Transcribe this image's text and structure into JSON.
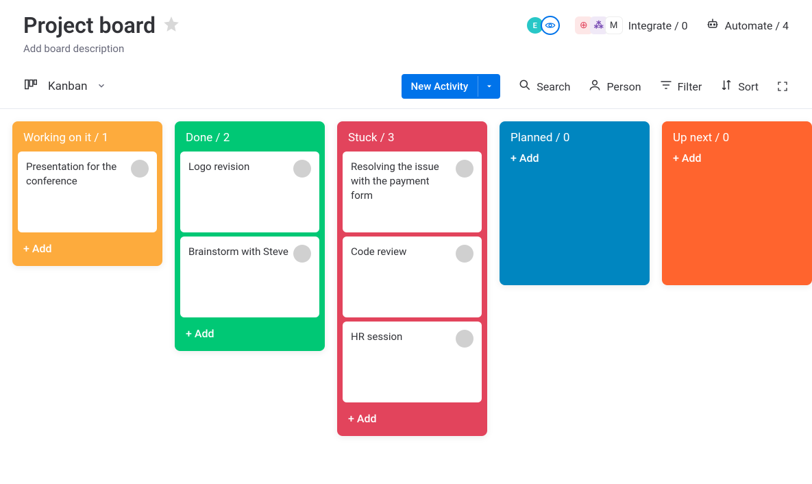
{
  "header": {
    "title": "Project board",
    "description_placeholder": "Add board description",
    "avatar1_initial": "E",
    "integrate_label": "Integrate / 0",
    "automate_label": "Automate / 4"
  },
  "toolbar": {
    "view_name": "Kanban",
    "new_activity_label": "New Activity",
    "search_label": "Search",
    "person_label": "Person",
    "filter_label": "Filter",
    "sort_label": "Sort"
  },
  "columns": [
    {
      "title": "Working on it / 1",
      "color": "#fdab3d",
      "add_label": "+ Add",
      "cards": [
        {
          "text": "Presentation for the conference"
        }
      ]
    },
    {
      "title": "Done / 2",
      "color": "#00c875",
      "add_label": "+ Add",
      "cards": [
        {
          "text": "Logo revision"
        },
        {
          "text": "Brainstorm with Steve"
        }
      ]
    },
    {
      "title": "Stuck / 3",
      "color": "#e2445c",
      "add_label": "+ Add",
      "cards": [
        {
          "text": "Resolving the issue with the payment form"
        },
        {
          "text": "Code review"
        },
        {
          "text": "HR session"
        }
      ]
    },
    {
      "title": "Planned / 0",
      "color": "#0086c0",
      "add_label": "+ Add",
      "cards": []
    },
    {
      "title": "Up next / 0",
      "color": "#ff642e",
      "add_label": "+ Add",
      "cards": []
    }
  ]
}
